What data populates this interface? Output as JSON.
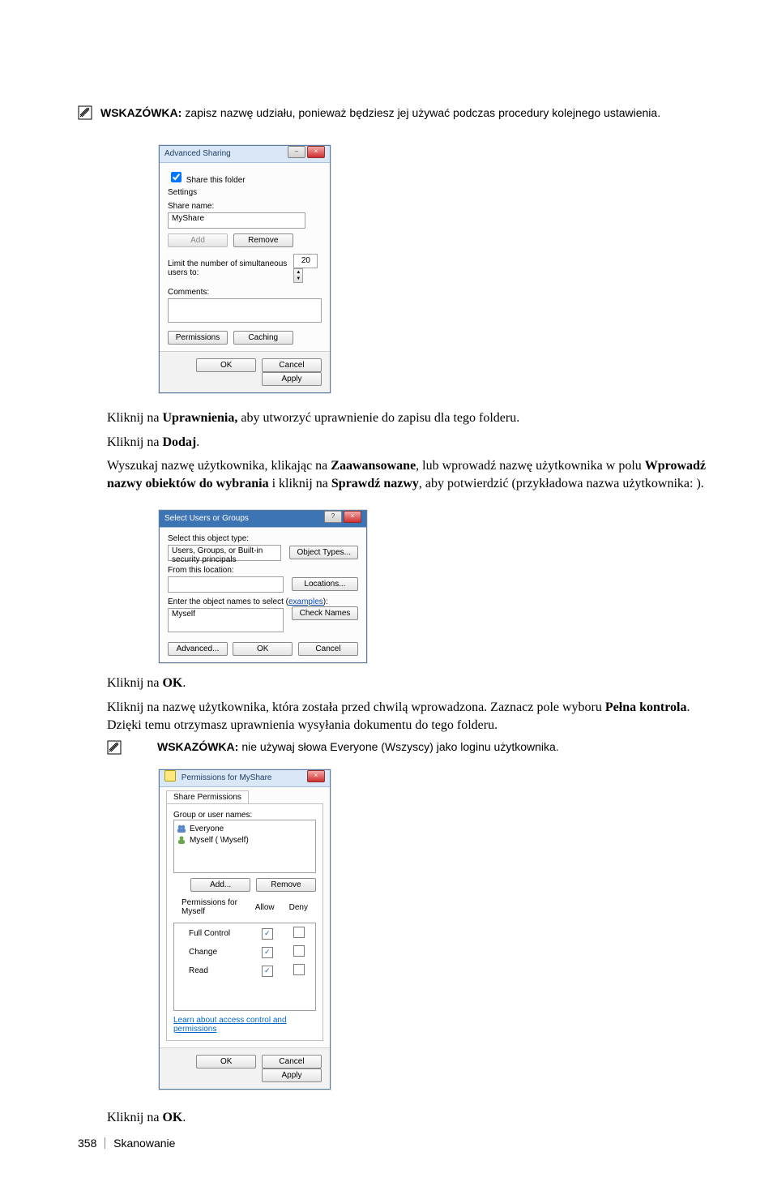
{
  "hints": {
    "label": "WSKAZÓWKA:",
    "hint1": "zapisz nazwę udziału, ponieważ będziesz jej używać podczas procedury kolejnego ustawienia.",
    "hint2": "nie używaj słowa Everyone (Wszyscy) jako loginu użytkownika."
  },
  "body": {
    "p1_a": "Kliknij na ",
    "p1_b": "Uprawnienia,",
    "p1_c": " aby utworzyć uprawnienie do zapisu dla tego folderu.",
    "p2_a": "Kliknij na ",
    "p2_b": "Dodaj",
    "p2_c": ".",
    "p3_a": "Wyszukaj nazwę użytkownika, klikając na ",
    "p3_b": "Zaawansowane",
    "p3_c": ", lub wprowadź nazwę użytkownika w polu ",
    "p3_d": "Wprowadź nazwy obiektów do wybrania",
    "p3_e": " i kliknij na ",
    "p3_f": "Sprawdź nazwy",
    "p3_g": ", aby potwierdzić (przykładowa nazwa użytkownika:     ).",
    "p4_a": "Kliknij na ",
    "p4_b": "OK",
    "p4_c": ".",
    "p5_a": "Kliknij na nazwę użytkownika, która została przed chwilą wprowadzona. Zaznacz pole wyboru ",
    "p5_b": "Pełna kontrola",
    "p5_c": ". Dzięki temu otrzymasz uprawnienia wysyłania dokumentu do tego folderu.",
    "p6_a": "Kliknij na ",
    "p6_b": "OK",
    "p6_c": "."
  },
  "dlg_advanced": {
    "title": "Advanced Sharing",
    "share_cb": "Share this folder",
    "settings": "Settings",
    "share_name_label": "Share name:",
    "share_name_value": "MyShare",
    "add": "Add",
    "remove": "Remove",
    "limit_label": "Limit the number of simultaneous users to:",
    "limit_value": "20",
    "comments_label": "Comments:",
    "permissions": "Permissions",
    "caching": "Caching",
    "ok": "OK",
    "cancel": "Cancel",
    "apply": "Apply"
  },
  "dlg_select": {
    "title": "Select Users or Groups",
    "object_type_label": "Select this object type:",
    "object_type_value": "Users, Groups, or Built-in security principals",
    "object_types_btn": "Object Types...",
    "location_label": "From this location:",
    "location_value": " ",
    "locations_btn": "Locations...",
    "enter_names_label_a": "Enter the object names to select (",
    "enter_names_label_b": "examples",
    "enter_names_label_c": "):",
    "enter_value": "Myself",
    "check_names": "Check Names",
    "advanced": "Advanced...",
    "ok": "OK",
    "cancel": "Cancel"
  },
  "dlg_perm": {
    "title": "Permissions for MyShare",
    "tab": "Share Permissions",
    "group_users_label": "Group or user names:",
    "user1": "Everyone",
    "user2": "Myself (            \\Myself)",
    "add": "Add...",
    "remove": "Remove",
    "perm_for": "Permissions for Myself",
    "allow": "Allow",
    "deny": "Deny",
    "full": "Full Control",
    "change": "Change",
    "read": "Read",
    "learn": "Learn about access control and permissions",
    "ok": "OK",
    "cancel": "Cancel",
    "apply": "Apply"
  },
  "footer": {
    "page": "358",
    "section": "Skanowanie"
  }
}
